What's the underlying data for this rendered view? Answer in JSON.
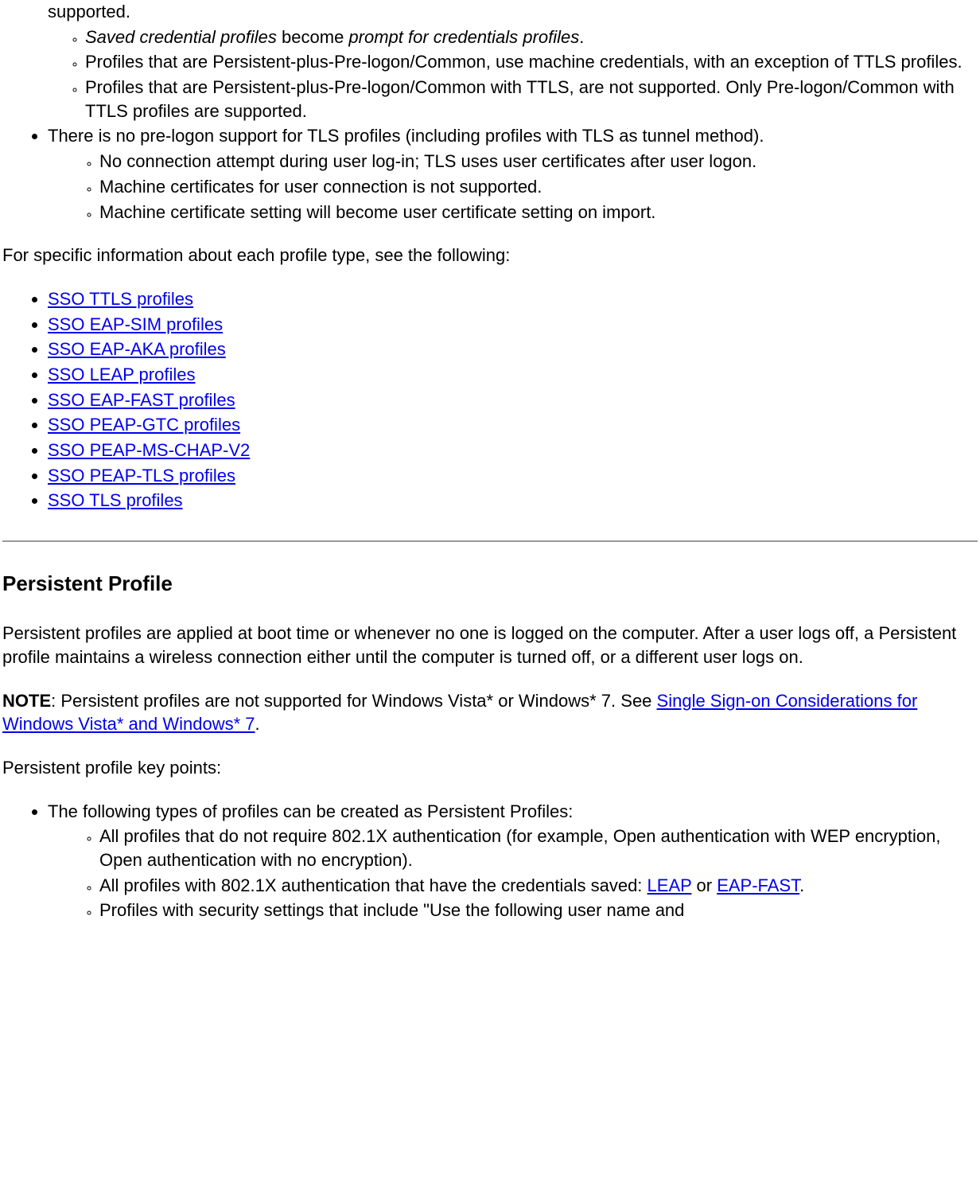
{
  "top_list": {
    "item0_frag": "supported.",
    "item0_sub": [
      {
        "prefix_italic": "Saved credential profiles",
        "mid": " become ",
        "suffix_italic": "prompt for credentials profiles",
        "end": "."
      },
      {
        "text": "Profiles that are Persistent-plus-Pre-logon/Common, use machine credentials, with an exception of TTLS profiles."
      },
      {
        "text": "Profiles that are Persistent-plus-Pre-logon/Common with TTLS, are not supported. Only Pre-logon/Common with TTLS profiles are supported."
      }
    ],
    "item1": "There is no pre-logon support for TLS profiles (including profiles with TLS as tunnel method).",
    "item1_sub": [
      {
        "text": "No connection attempt during user log-in; TLS uses user certificates after user logon."
      },
      {
        "text": "Machine certificates for user connection is not supported."
      },
      {
        "text": "Machine certificate setting will become user certificate setting on import."
      }
    ]
  },
  "para_specific": "For specific information about each profile type, see the following:",
  "sso_links": [
    "SSO TTLS profiles",
    "SSO EAP-SIM profiles",
    "SSO EAP-AKA profiles",
    "SSO LEAP profiles",
    "SSO EAP-FAST profiles",
    "SSO PEAP-GTC profiles",
    "SSO PEAP-MS-CHAP-V2",
    "SSO PEAP-TLS profiles",
    "SSO TLS profiles"
  ],
  "heading": "Persistent Profile",
  "para_desc": "Persistent profiles are applied at boot time or whenever no one is logged on the computer. After a user logs off, a Persistent profile maintains a wireless connection either until the computer is turned off, or a different user logs on.",
  "note": {
    "label": "NOTE",
    "text1": ": Persistent profiles are not supported for Windows Vista* or Windows* 7. See ",
    "link": "Single Sign-on Considerations for Windows Vista* and Windows* 7",
    "text2": "."
  },
  "para_keypoints": "Persistent profile key points:",
  "keypoints": {
    "item0": "The following types of profiles can be created as Persistent Profiles:",
    "item0_sub": [
      {
        "text": "All profiles that do not require 802.1X authentication (for example, Open authentication with WEP encryption, Open authentication with no encryption)."
      },
      {
        "pre": "All profiles with 802.1X authentication that have the credentials saved: ",
        "link1": "LEAP",
        "mid": " or ",
        "link2": "EAP-FAST",
        "post": "."
      },
      {
        "text": "Profiles with security settings that include \"Use the following user name and"
      }
    ]
  }
}
